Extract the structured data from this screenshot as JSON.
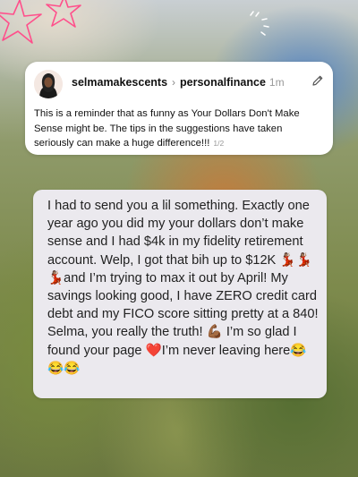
{
  "post": {
    "username": "selmamakescents",
    "community": "personalfinance",
    "time": "1m",
    "text": "This is a reminder that as funny as Your Dollars Don't Make Sense might be. The tips in the suggestions have taken seriously can make a huge difference!!!",
    "page_indicator": "1/2"
  },
  "message": {
    "text": "I had to send you a lil something. Exactly one year ago you did my your dollars don’t make sense and I had $4k in my fidelity retirement account. Welp, I got that bih up to $12K 💃🏽💃🏽💃🏽and I’m trying to max it out by April! My savings looking good, I have ZERO credit card debt and my FICO score sitting pretty at a 840! Selma, you really the truth! 💪🏾 I’m so glad I found your page ❤️I’m never leaving here😂😂😂"
  },
  "icons": {
    "edit": "pencil-icon",
    "chevron": "chevron-right-icon",
    "decor": [
      "star-doodle-icon",
      "sparkle-lines-icon"
    ]
  },
  "colors": {
    "star_doodle": "#ff4f8b",
    "bubble_bg": "#ebe9ee",
    "card_bg": "#ffffff"
  }
}
